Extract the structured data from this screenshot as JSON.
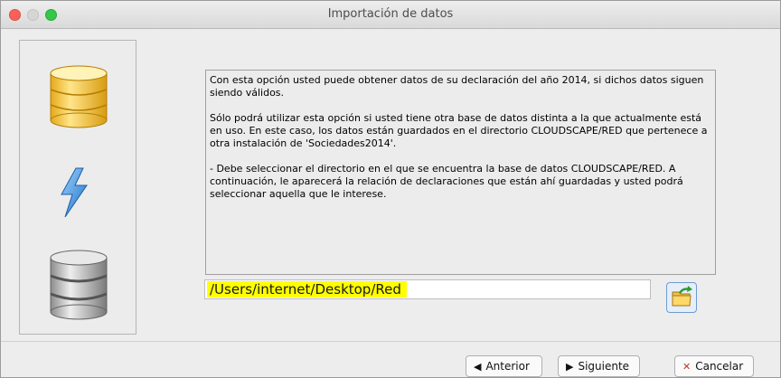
{
  "window": {
    "title": "Importación de datos"
  },
  "info": {
    "paragraphs": [
      "Con esta opción usted puede obtener datos de su declaración del año 2014, si dichos datos siguen siendo válidos.",
      "Sólo podrá utilizar esta opción si usted tiene otra base de datos distinta a la que actualmente está en uso. En este caso, los datos están guardados en el directorio CLOUDSCAPE/RED que pertenece a otra instalación de 'Sociedades2014'.",
      "- Debe seleccionar el directorio en el que se encuentra la base de datos CLOUDSCAPE/RED. A continuación, le aparecerá la relación de declaraciones que están ahí guardadas y usted podrá seleccionar aquella que le interese."
    ]
  },
  "path_field": {
    "value": "/Users/internet/Desktop/Red"
  },
  "buttons": {
    "previous": "Anterior",
    "next": "Siguiente",
    "cancel": "Cancelar"
  },
  "colors": {
    "highlight": "#ffff00",
    "close": "#fc605b",
    "maximize": "#34c84a",
    "database_gold": "#f2c94c",
    "database_gray": "#9a9a9a",
    "bolt_blue": "#2f7fd1"
  },
  "icons": {
    "sidebar": [
      "database-gold-icon",
      "lightning-icon",
      "database-gray-icon"
    ],
    "folder_button": "folder-arrow-icon",
    "previous": "triangle-left-icon",
    "next": "triangle-right-icon",
    "cancel": "x-icon"
  }
}
